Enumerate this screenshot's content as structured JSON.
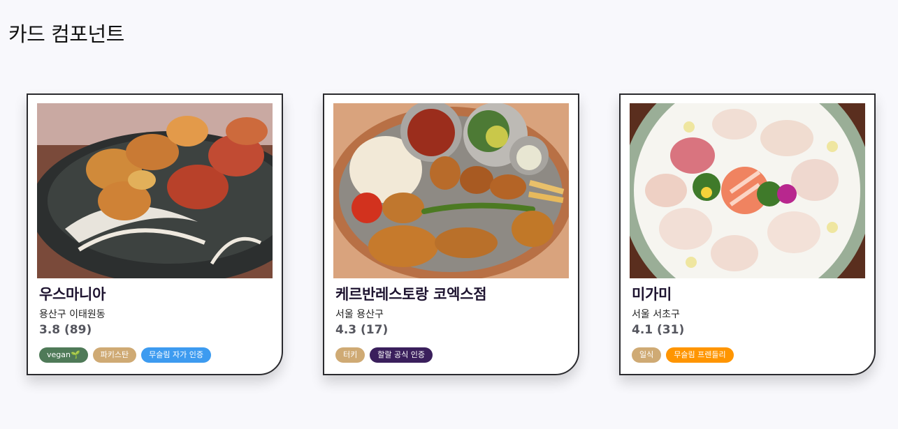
{
  "page": {
    "title": "카드 컴포넌트"
  },
  "colors": {
    "vegan": "#4f7a58",
    "cuisine": "#cfaa74",
    "muslim_cert": "#3d9bf0",
    "halal_official": "#3a1f5c",
    "muslim_friendly": "#ff9500"
  },
  "cards": [
    {
      "name": "우스마니아",
      "location": "용산구 이태원동",
      "rating": "3.8 (89)",
      "photo_icon": "tandoori-chicken-photo",
      "tags": [
        {
          "label": "vegan🌱",
          "color": "#4f7a58"
        },
        {
          "label": "파키스탄",
          "color": "#cfaa74"
        },
        {
          "label": "무슬림 자가 인증",
          "color": "#3d9bf0"
        }
      ]
    },
    {
      "name": "케르반레스토랑 코엑스점",
      "location": "서울 용산구",
      "rating": "4.3 (17)",
      "photo_icon": "turkish-platter-photo",
      "tags": [
        {
          "label": "터키",
          "color": "#cfaa74"
        },
        {
          "label": "할랄 공식 인증",
          "color": "#3a1f5c"
        }
      ]
    },
    {
      "name": "미가미",
      "location": "서울 서초구",
      "rating": "4.1 (31)",
      "photo_icon": "sashimi-platter-photo",
      "tags": [
        {
          "label": "일식",
          "color": "#cfaa74"
        },
        {
          "label": "무슬림 프렌들리",
          "color": "#ff9500"
        }
      ]
    }
  ]
}
